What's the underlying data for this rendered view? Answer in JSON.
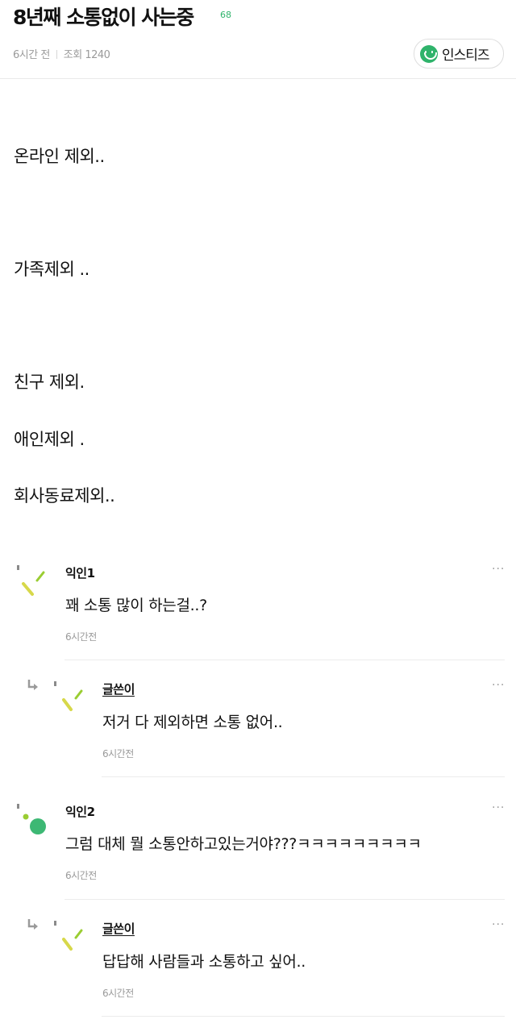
{
  "post": {
    "title": "8년째 소통없이 사는중",
    "comment_count": "68",
    "time": "6시간 전",
    "views": "조회 1240",
    "board_label": "인스티즈",
    "body_lines": [
      "온라인 제외..",
      "가족제외 ..",
      "친구 제외.",
      "애인제외 .",
      "회사동료제외.."
    ]
  },
  "comments": [
    {
      "author": "익인1",
      "text": "꽤 소통 많이 하는걸..?",
      "time": "6시간전",
      "more": "···"
    },
    {
      "author": "글쓴이",
      "text": "저거 다 제외하면 소통 없어..",
      "time": "6시간전",
      "more": "···"
    },
    {
      "author": "익인2",
      "text": "그럼 대체 뭘 소통안하고있는거야???ㅋㅋㅋㅋㅋㅋㅋㅋㅋ",
      "time": "6시간전",
      "more": "···"
    },
    {
      "author": "글쓴이",
      "text": "답답해 사람들과 소통하고 싶어..",
      "time": "6시간전",
      "more": "···"
    }
  ],
  "colors": {
    "accent_green": "#2fb36b",
    "avatar_lime": "#9acd32",
    "avatar_yellow": "#d7d84a",
    "muted_text": "#9a9a9a"
  },
  "icons": {
    "board_badge": "smile-icon",
    "comment_more": "more-dots-icon",
    "reply": "reply-arrow-icon",
    "avatar": "anonymous-avatar-icon"
  }
}
